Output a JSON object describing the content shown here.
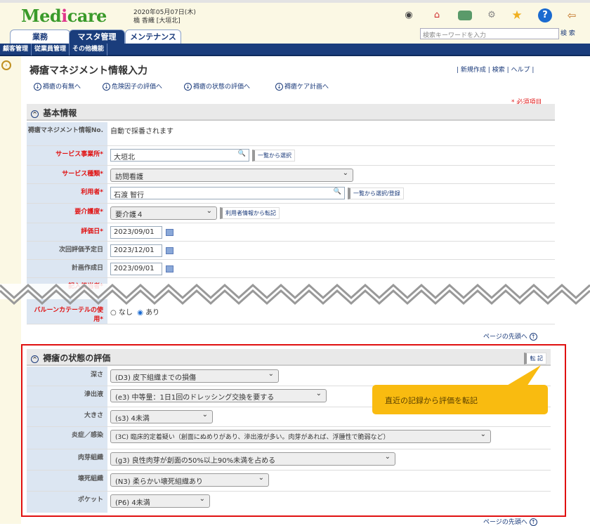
{
  "header": {
    "logo": "Medicare",
    "date": "2020年05月07日(木)",
    "user": "橋 香織 [大垣北]",
    "search_placeholder": "検索キーワードを入力",
    "search_button": "検 索"
  },
  "tabs": [
    {
      "label": "業務"
    },
    {
      "label": "マスタ管理"
    },
    {
      "label": "メンテナンス"
    }
  ],
  "subnav": [
    {
      "label": "顧客管理"
    },
    {
      "label": "従業員管理"
    },
    {
      "label": "その他機能"
    }
  ],
  "page": {
    "title": "褥瘡マネジメント情報入力",
    "links": {
      "new": "新規作成",
      "search": "検索",
      "help": "ヘルプ"
    },
    "anchors": [
      "褥瘡の有無へ",
      "危険因子の評価へ",
      "褥瘡の状態の評価へ",
      "褥瘡ケア計画へ"
    ],
    "required_note": "* 必須項目",
    "page_top": "ページの先頭へ"
  },
  "basic": {
    "title": "基本情報",
    "rows": [
      {
        "label": "褥瘡マネジメント情報No.",
        "value": "自動で採番されます"
      },
      {
        "label": "サービス事業所*",
        "value": "大垣北",
        "button": "一覧から選択"
      },
      {
        "label": "サービス種類*",
        "value": "訪問看護"
      },
      {
        "label": "利用者*",
        "value": "石渡 智行",
        "button": "一覧から選択/登録"
      },
      {
        "label": "要介護度*",
        "value": "要介護４",
        "button": "利用者情報から転記"
      },
      {
        "label": "評価日*",
        "value": "2023/09/01"
      },
      {
        "label": "次回評価予定日",
        "value": "2023/12/01"
      },
      {
        "label": "計画作成日",
        "value": "2023/09/01"
      },
      {
        "label": "記入担当者*"
      },
      {
        "label": "バルーンカテーテルの使用*",
        "options": [
          "なし",
          "あり"
        ],
        "selected": "あり"
      }
    ]
  },
  "state": {
    "title": "褥瘡の状態の評価",
    "copy_button": "転 記",
    "callout": "直近の記録から評価を転記",
    "rows": [
      {
        "label": "深さ",
        "value": "(D3) 皮下組織までの損傷"
      },
      {
        "label": "滲出液",
        "value": "(e3) 中等量：1日1回のドレッシング交換を要する"
      },
      {
        "label": "大きさ",
        "value": "(s3) 4未満"
      },
      {
        "label": "炎症／感染",
        "value": "(3C) 臨床的定着疑い（創面にぬめりがあり、滲出液が多い。肉芽があれば、浮腫性で脆弱など）"
      },
      {
        "label": "肉芽組織",
        "value": "(g3) 良性肉芽が創面の50%以上90%未満を占める"
      },
      {
        "label": "壊死組織",
        "value": "(N3) 柔らかい壊死組織あり"
      },
      {
        "label": "ポケット",
        "value": "(P6) 4未満"
      }
    ]
  }
}
